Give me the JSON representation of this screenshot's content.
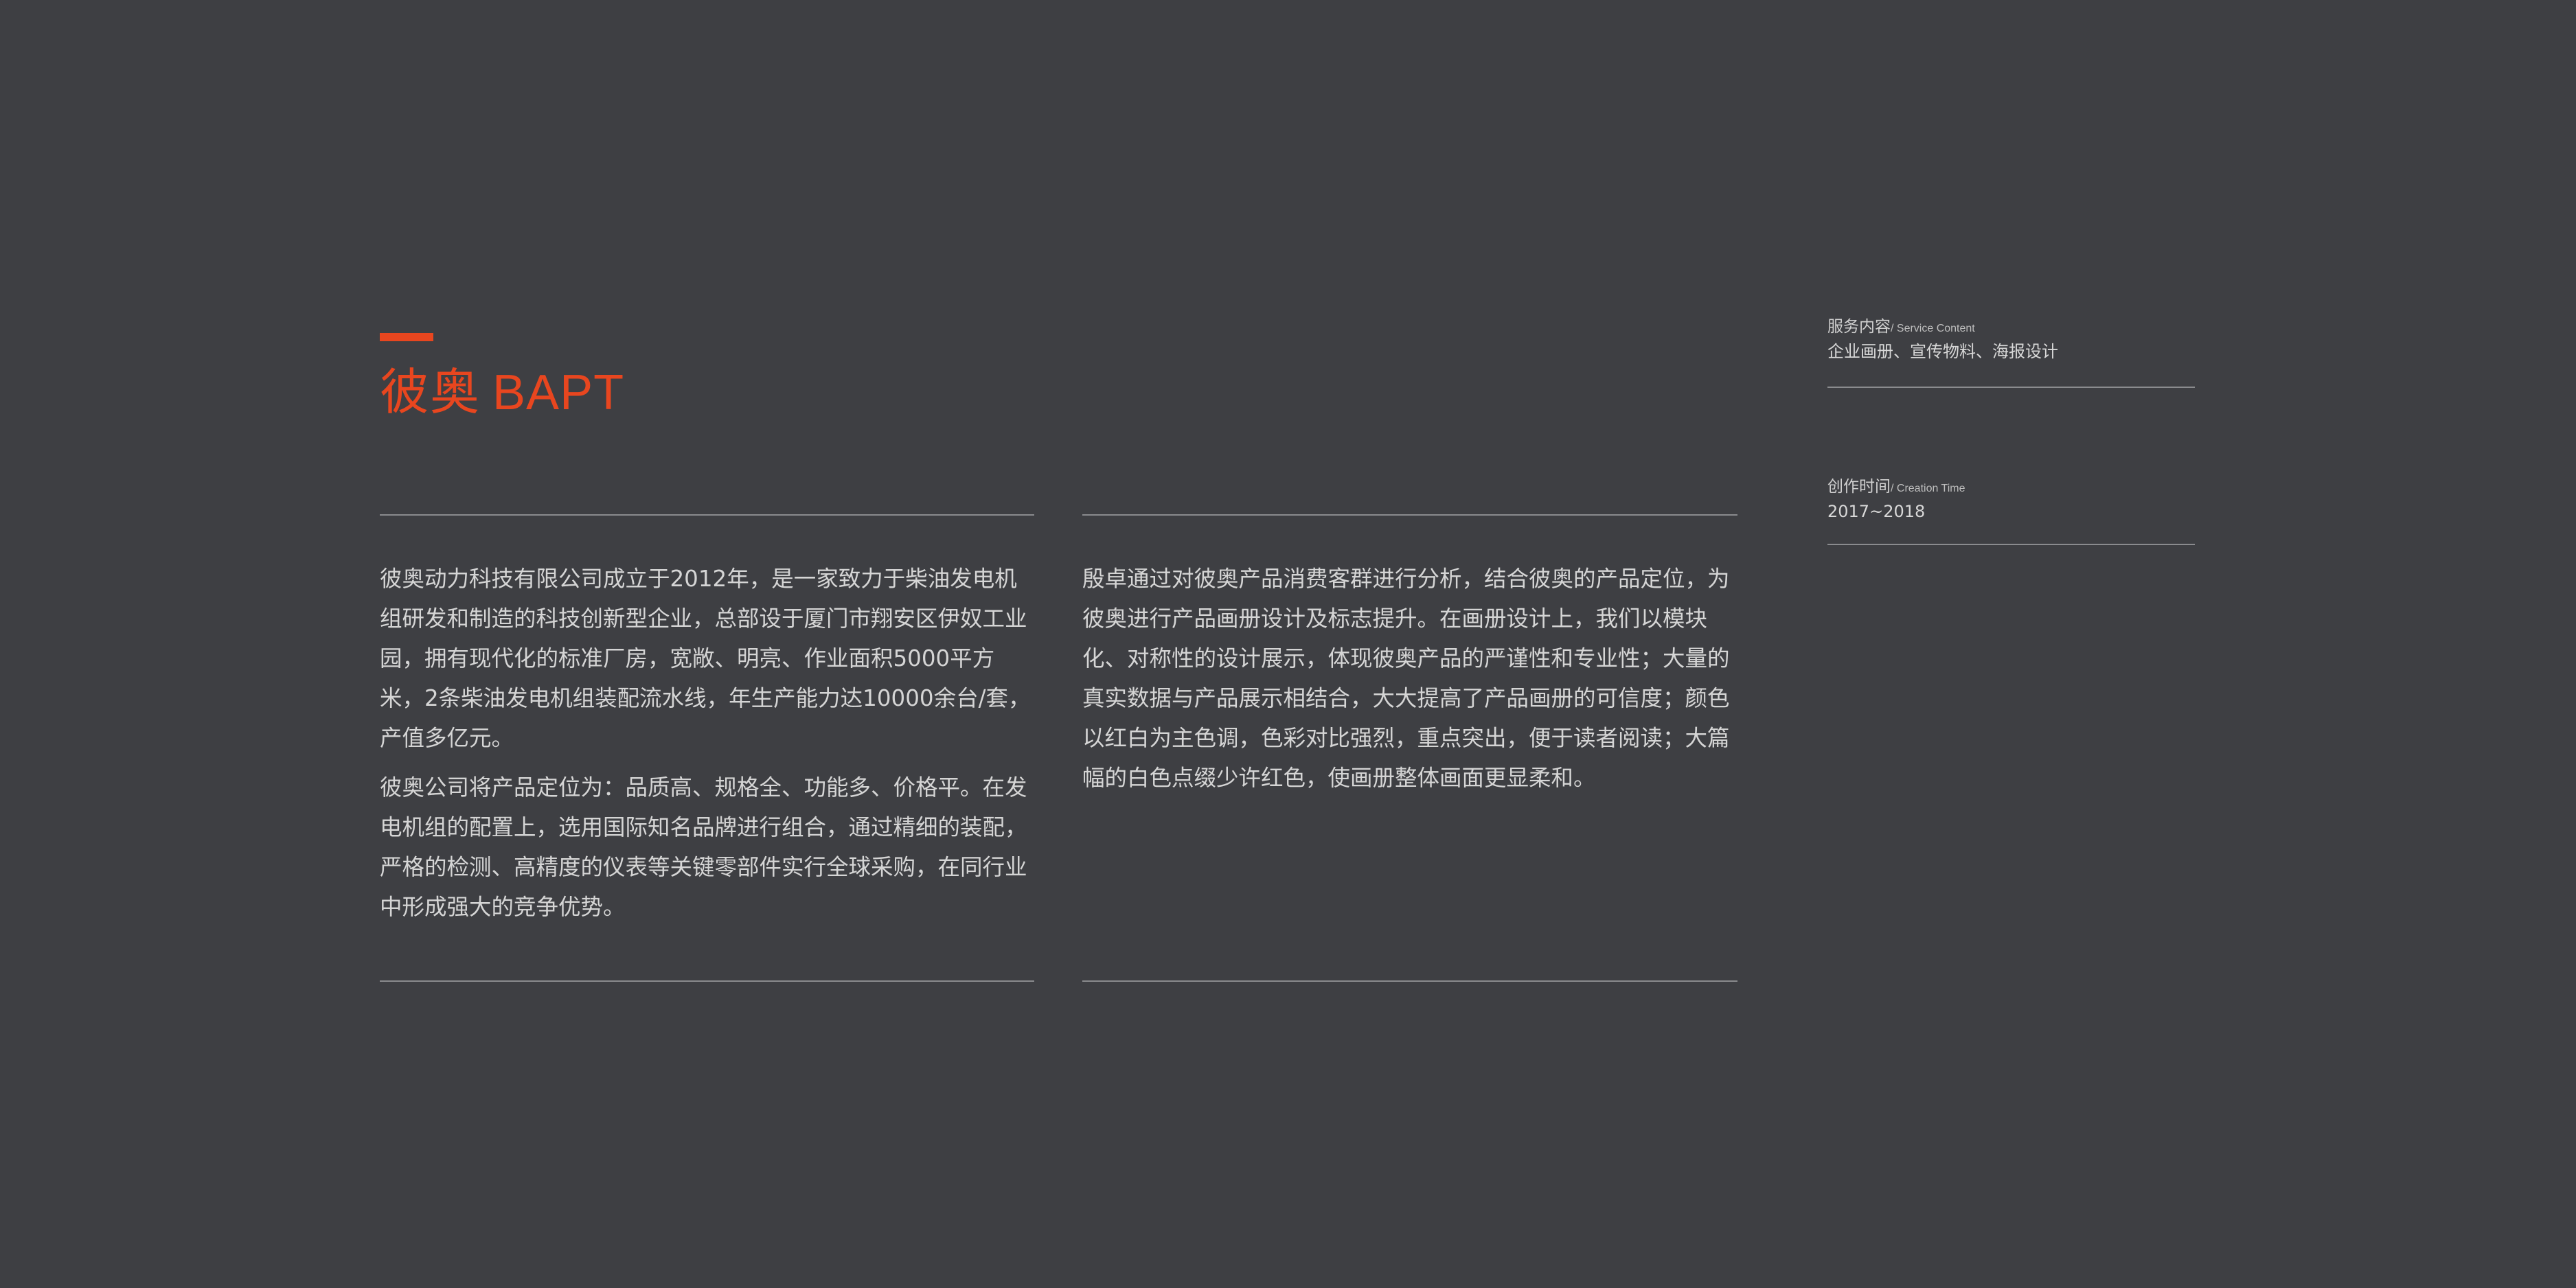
{
  "header": {
    "title_cn": "彼奥",
    "title_en": "BAPT"
  },
  "intro": {
    "paragraphs": [
      "彼奥动力科技有限公司成立于2012年，是一家致力于柴油发电机组研发和制造的科技创新型企业，总部设于厦门市翔安区伊奴工业园，拥有现代化的标准厂房，宽敞、明亮、作业面积5000平方米，2条柴油发电机组装配流水线，年生产能力达10000余台/套，产值多亿元。",
      "彼奥公司将产品定位为：品质高、规格全、功能多、价格平。在发电机组的配置上，选用国际知名品牌进行组合，通过精细的装配，严格的检测、高精度的仪表等关键零部件实行全球采购，在同行业中形成强大的竞争优势。"
    ]
  },
  "design": {
    "paragraphs": [
      "殷卓通过对彼奥产品消费客群进行分析，结合彼奥的产品定位，为彼奥进行产品画册设计及标志提升。在画册设计上，我们以模块化、对称性的设计展示，体现彼奥产品的严谨性和专业性；大量的真实数据与产品展示相结合，大大提高了产品画册的可信度；颜色以红白为主色调，色彩对比强烈，重点突出，便于读者阅读；大篇幅的白色点缀少许红色，使画册整体画面更显柔和。"
    ]
  },
  "meta": {
    "service": {
      "label_cn": "服务内容",
      "label_en": "/ Service Content",
      "value": "企业画册、宣传物料、海报设计"
    },
    "time": {
      "label_cn": "创作时间",
      "label_en": "/ Creation Time",
      "value": "2017~2018"
    }
  },
  "colors": {
    "background": "#3e3f43",
    "accent": "#e8461f",
    "text": "#d5d5d5",
    "rule": "#8a8b8e"
  }
}
